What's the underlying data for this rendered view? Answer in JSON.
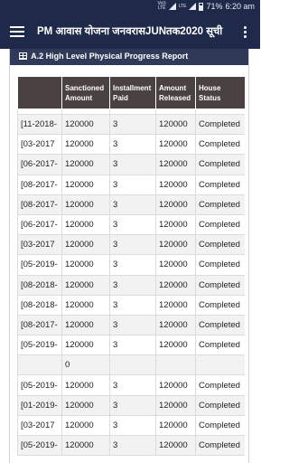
{
  "status_bar": {
    "net_top": "Vo))",
    "net_mid": "LTE",
    "net_bot": "LTE",
    "battery": "71%",
    "time": "6:20 am"
  },
  "app_bar": {
    "title": "PM आवास योजना जनवरासJUNतक2020 सूची"
  },
  "panel": {
    "heading": "A.2 High Level Physical Progress Report"
  },
  "table": {
    "headers": [
      "",
      "Sanctioned Amount",
      "Installment Paid",
      "Amount Released",
      "House Status"
    ],
    "rows": [
      [
        "-11-2018]",
        "120000",
        "3",
        "120000",
        "Completed"
      ],
      [
        "03-2017]",
        "120000",
        "3",
        "120000",
        "Completed"
      ],
      [
        "-06-2017]",
        "120000",
        "3",
        "120000",
        "Completed"
      ],
      [
        "-08-2017]",
        "120000",
        "3",
        "120000",
        "Completed"
      ],
      [
        "-08-2017]",
        "120000",
        "3",
        "120000",
        "Completed"
      ],
      [
        "-06-2017]",
        "120000",
        "3",
        "120000",
        "Completed"
      ],
      [
        "03-2017]",
        "120000",
        "3",
        "120000",
        "Completed"
      ],
      [
        "-05-2019]",
        "120000",
        "3",
        "120000",
        "Completed"
      ],
      [
        "-08-2018]",
        "120000",
        "3",
        "120000",
        "Completed"
      ],
      [
        "-08-2018]",
        "120000",
        "3",
        "120000",
        "Completed"
      ],
      [
        "-08-2017]",
        "120000",
        "3",
        "120000",
        "Completed"
      ],
      [
        "-05-2019]",
        "120000",
        "3",
        "120000",
        "Completed"
      ],
      [
        "",
        "0",
        "",
        "",
        ""
      ],
      [
        "-05-2019]",
        "120000",
        "3",
        "120000",
        "Completed"
      ],
      [
        "-01-2019]",
        "120000",
        "3",
        "120000",
        "Completed"
      ],
      [
        "03-2017]",
        "120000",
        "3",
        "120000",
        "Completed"
      ],
      [
        "-05-2019]",
        "120000",
        "3",
        "120000",
        "Completed"
      ]
    ]
  }
}
